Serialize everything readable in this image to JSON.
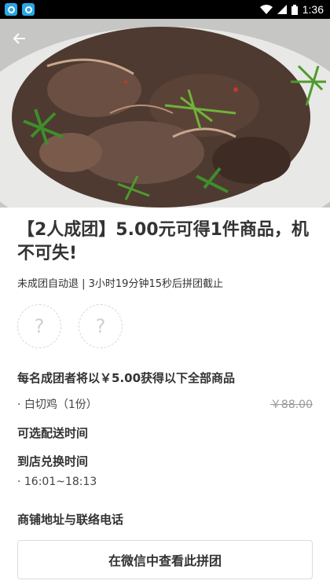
{
  "status": {
    "time": "1:36"
  },
  "page": {
    "title": "【2人成团】5.00元可得1件商品，机不可失!",
    "subtitle": "未成团自动退 | 3小时19分钟15秒后拼团截止",
    "avatar_placeholders": [
      "?",
      "?"
    ]
  },
  "items_section": {
    "heading": "每名成团者将以￥5.00获得以下全部商品",
    "item_name": "· 白切鸡（1份）",
    "item_price": "￥88.00"
  },
  "delivery": {
    "heading": "可选配送时间"
  },
  "pickup": {
    "heading": "到店兑换时间",
    "time": "· 16:01~18:13"
  },
  "shop": {
    "heading": "商铺地址与联络电话"
  },
  "actions": {
    "wechat_button": "在微信中查看此拼团"
  }
}
